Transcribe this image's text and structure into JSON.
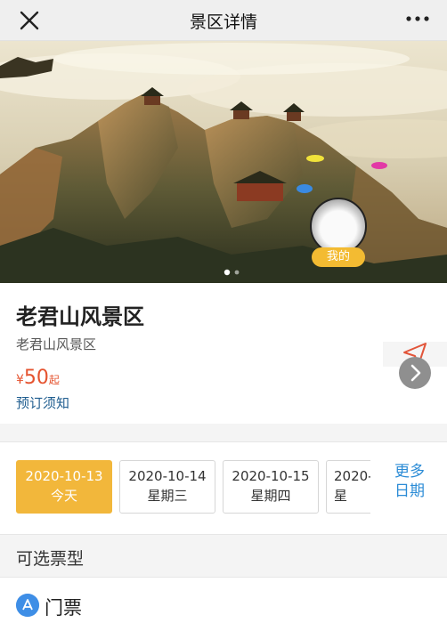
{
  "nav": {
    "title": "景区详情",
    "close_icon": "close-icon",
    "more_icon": "more-dots-icon"
  },
  "hero": {
    "badge_label": "我的",
    "page_count": 2,
    "active_page": 1
  },
  "info": {
    "name": "老君山风景区",
    "subtitle": "老君山风景区",
    "price_currency": "¥",
    "price_value": "50",
    "price_suffix": "起",
    "notice_label": "预订须知"
  },
  "dates": [
    {
      "date": "2020-10-13",
      "weekday": "今天",
      "selected": true
    },
    {
      "date": "2020-10-14",
      "weekday": "星期三",
      "selected": false
    },
    {
      "date": "2020-10-15",
      "weekday": "星期四",
      "selected": false
    },
    {
      "date": "2020-",
      "weekday": "星",
      "selected": false
    }
  ],
  "more_dates": {
    "line1": "更多",
    "line2": "日期"
  },
  "section": {
    "title": "可选票型"
  },
  "ticket": {
    "label": "门票"
  },
  "colors": {
    "accent": "#f2b73b",
    "price": "#e5532f",
    "link": "#1f5d8f",
    "more": "#2c8cd6"
  }
}
